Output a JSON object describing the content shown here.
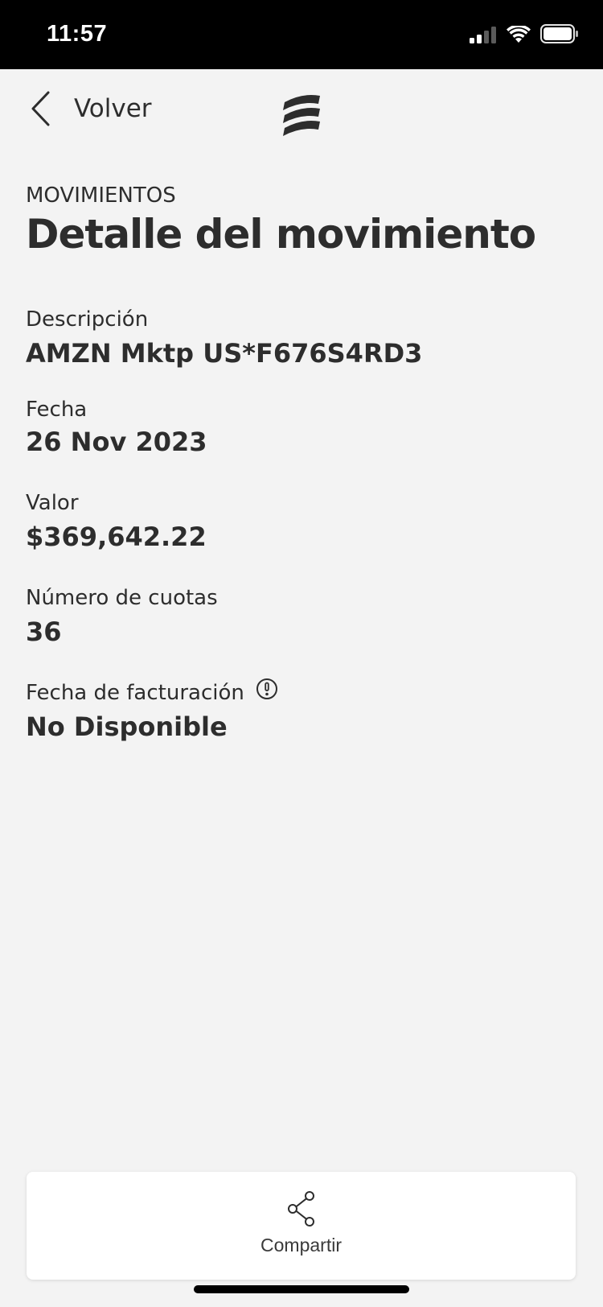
{
  "status_bar": {
    "time": "11:57",
    "icons": [
      "cellular-signal-icon",
      "wifi-icon",
      "battery-icon"
    ]
  },
  "nav": {
    "back_label": "Volver",
    "back_icon": "chevron-left-icon",
    "logo_icon": "bank-logo-icon"
  },
  "header": {
    "section": "MOVIMIENTOS",
    "title": "Detalle del movimiento"
  },
  "details": [
    {
      "label": "Descripción",
      "value": "AMZN Mktp US*F676S4RD3"
    },
    {
      "label": "Fecha",
      "value": "26 Nov 2023"
    },
    {
      "label": "Valor",
      "value": "$369,642.22"
    },
    {
      "label": "Número de cuotas",
      "value": "36"
    },
    {
      "label": "Fecha de facturación",
      "value": "No Disponible",
      "icon": "info-icon"
    }
  ],
  "share": {
    "label": "Compartir",
    "icon": "share-icon"
  },
  "colors": {
    "background": "#f3f3f3",
    "text": "#2d2d2d",
    "status_bar": "#000000",
    "card": "#ffffff"
  }
}
